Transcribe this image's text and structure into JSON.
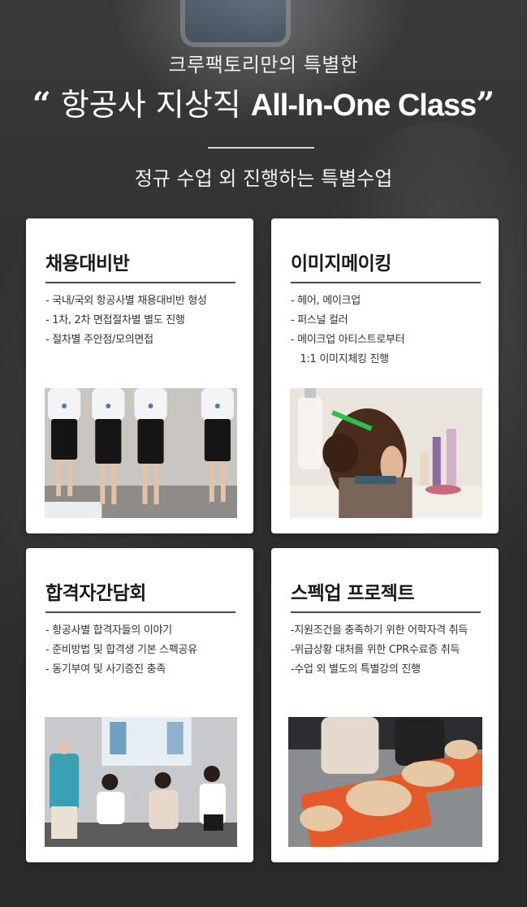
{
  "header": {
    "subtitle": "크루팩토리만의 특별한",
    "title_open_quote": "“",
    "title_korean": "항공사 지상직",
    "title_english": "All-In-One Class",
    "title_close_quote": "”",
    "tagline": "정규 수업 외 진행하는 특별수업"
  },
  "cards": [
    {
      "title": "채용대비반",
      "items": [
        "- 국내/국외 항공사별 채용대비반 형성",
        "- 1차, 2차 면접절차별 별도 진행",
        "- 절차별 주안점/모의면접"
      ],
      "photo_icon": "uniform-lineup-photo"
    },
    {
      "title": "이미지메이킹",
      "items": [
        "- 헤어, 메이크업",
        "- 퍼스널 컬러",
        "- 메이크업 아티스트로부터",
        "   1:1 이미지체킹 진행"
      ],
      "photo_icon": "hair-styling-photo"
    },
    {
      "title": "합격자간담회",
      "items": [
        "- 항공사별 합격자들의 이야기",
        "- 준비방법 및 합격생 기본 스펙공유",
        "- 동기부여 및 사기증진 충족"
      ],
      "photo_icon": "seminar-photo"
    },
    {
      "title": "스펙업 프로젝트",
      "items": [
        "-지원조건을 충족하기 위한 어학자격 취득",
        "-위급상황 대처를 위한 CPR수료증 취득",
        "-수업 외 별도의 특별강의 진행"
      ],
      "photo_icon": "cpr-training-photo"
    }
  ]
}
